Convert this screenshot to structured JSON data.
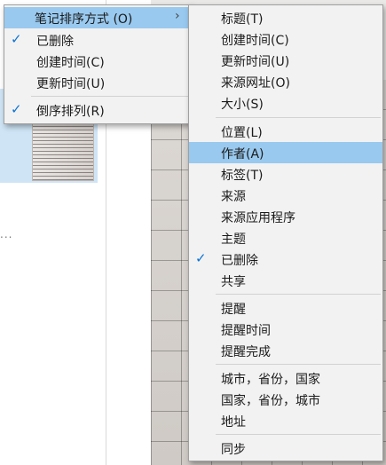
{
  "left_menu": {
    "items": [
      {
        "label": "笔记排序方式 (O)",
        "checked": false,
        "submenu": true,
        "highlighted": true
      },
      {
        "label": "已删除",
        "checked": true
      },
      {
        "label": "创建时间(C)",
        "checked": false
      },
      {
        "label": "更新时间(U)",
        "checked": false
      },
      {
        "label": "倒序排列(R)",
        "checked": true
      }
    ]
  },
  "right_menu": {
    "items": [
      {
        "label": "标题(T)"
      },
      {
        "label": "创建时间(C)"
      },
      {
        "label": "更新时间(U)"
      },
      {
        "label": "来源网址(O)"
      },
      {
        "label": "大小(S)"
      },
      {
        "label": "位置(L)"
      },
      {
        "label": "作者(A)",
        "highlighted": true
      },
      {
        "label": "标签(T)"
      },
      {
        "label": "来源"
      },
      {
        "label": "来源应用程序"
      },
      {
        "label": "主题"
      },
      {
        "label": "已删除",
        "checked": true
      },
      {
        "label": "共享"
      },
      {
        "label": "提醒"
      },
      {
        "label": "提醒时间"
      },
      {
        "label": "提醒完成"
      },
      {
        "label": "城市，省份，国家"
      },
      {
        "label": "国家，省份，城市"
      },
      {
        "label": "地址"
      },
      {
        "label": "同步"
      }
    ]
  },
  "background": {
    "ellipsis": "..."
  },
  "colors": {
    "menu_bg": "#f2f2f2",
    "highlight": "#99c9ef",
    "check": "#0b74d6"
  },
  "icons": {
    "check": "checkmark-icon",
    "submenu": "chevron-right-icon"
  }
}
